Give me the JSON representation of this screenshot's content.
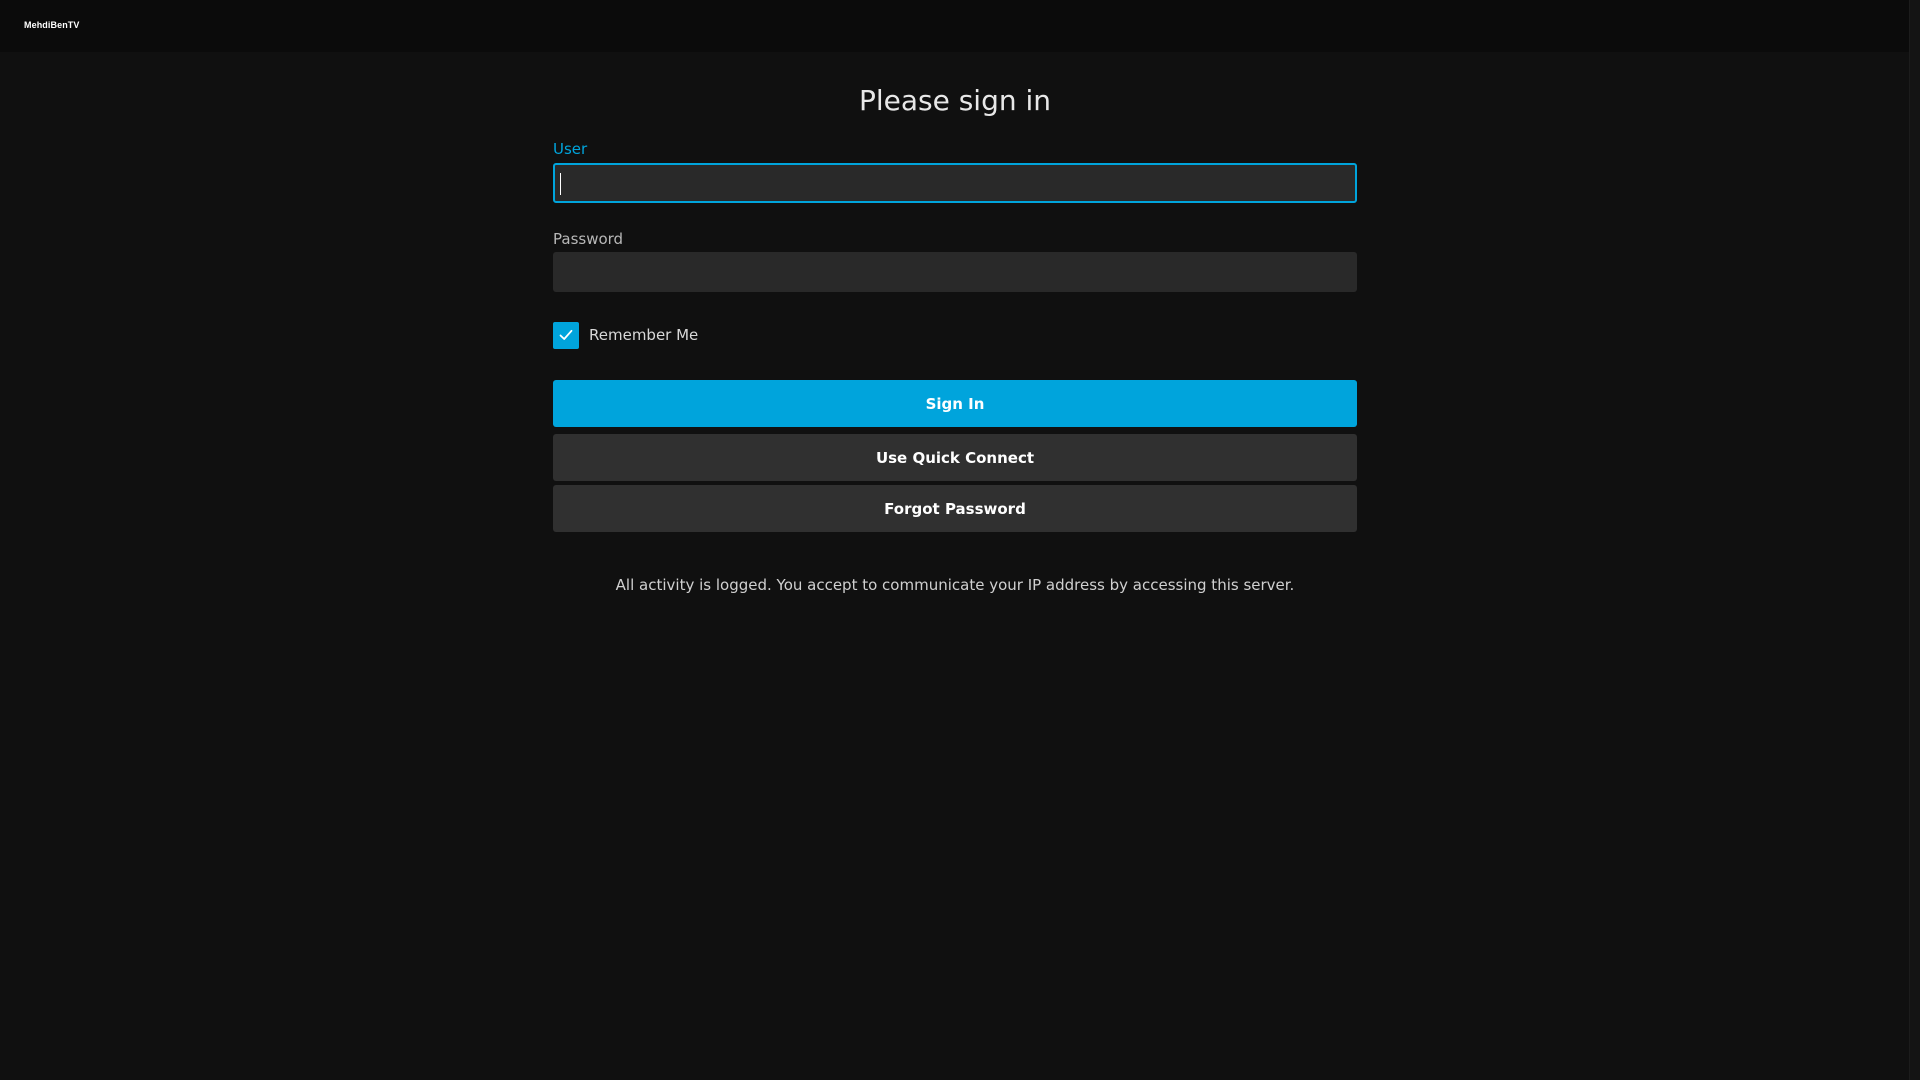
{
  "app": {
    "logo_text": "MehdiBenTV"
  },
  "login": {
    "title": "Please sign in",
    "user_label": "User",
    "user_value": "",
    "password_label": "Password",
    "password_value": "",
    "remember_me_label": "Remember Me",
    "remember_me_checked": true,
    "signin_label": "Sign In",
    "quick_connect_label": "Use Quick Connect",
    "forgot_password_label": "Forgot Password",
    "disclaimer": "All activity is logged. You accept to communicate your IP address by accessing this server."
  },
  "colors": {
    "accent": "#00a4dc",
    "background": "#101010",
    "header": "#0b0b0b",
    "input": "#292929",
    "secondary_button": "#303030"
  },
  "icons": {
    "checkbox": "check-icon"
  }
}
